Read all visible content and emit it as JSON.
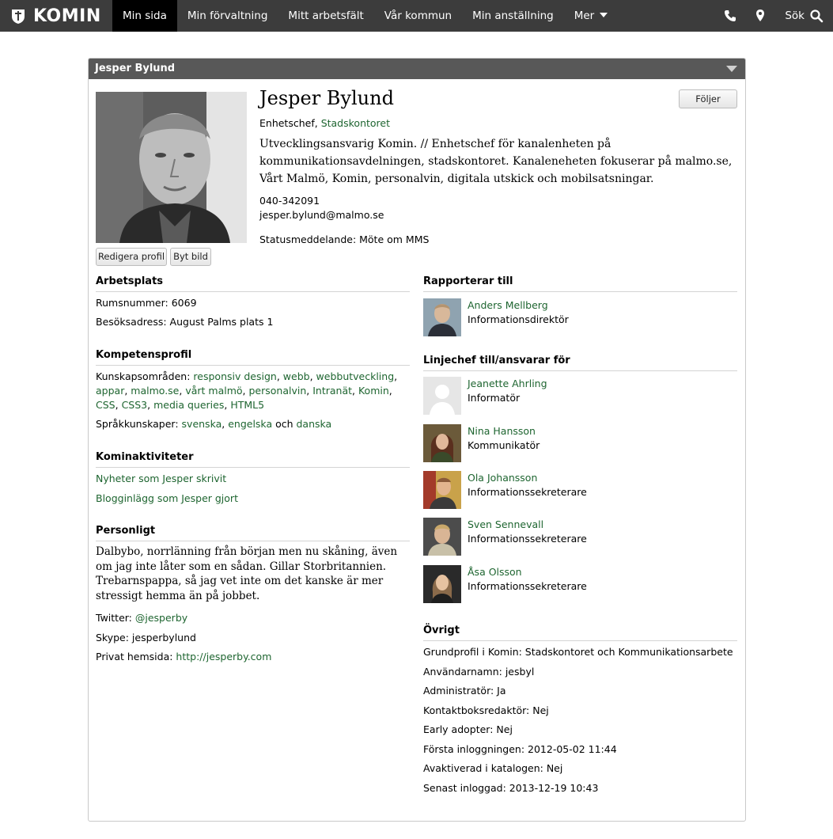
{
  "brand": "KOMIN",
  "nav": [
    {
      "label": "Min sida",
      "active": true
    },
    {
      "label": "Min förvaltning"
    },
    {
      "label": "Mitt arbetsfält"
    },
    {
      "label": "Vår kommun"
    },
    {
      "label": "Min anställning"
    },
    {
      "label": "Mer"
    }
  ],
  "topright": {
    "search_label": "Sök",
    "icons": [
      "phone-icon",
      "location-pin-icon",
      "search-icon"
    ]
  },
  "panel": {
    "title": "Jesper Bylund"
  },
  "profile": {
    "name": "Jesper Bylund",
    "role": "Enhetschef, ",
    "department": "Stadskontoret",
    "bio": "Utvecklingsansvarig Komin. // Enhetschef för kanalenheten på kommunikationsavdelningen, stadskontoret. Kanaleneheten fokuserar på malmo.se, Vårt Malmö, Komin, personalvin, digitala utskick och mobilsatsningar.",
    "phone": "040-342091",
    "email": "jesper.bylund@malmo.se",
    "status": "Statusmeddelande: Möte om MMS",
    "follow_label": "Följer",
    "edit_label": "Redigera profil",
    "change_image_label": "Byt bild"
  },
  "workplace": {
    "heading": "Arbetsplats",
    "room": "Rumsnummer: 6069",
    "address": "Besöksadress: August Palms plats 1"
  },
  "competence": {
    "heading": "Kompetensprofil",
    "areas_label": "Kunskapsområden: ",
    "areas": [
      "responsiv design",
      "webb",
      "webbutveckling",
      "appar",
      "malmo.se",
      "vårt malmö",
      "personalvin",
      "Intranät",
      "Komin",
      "CSS",
      "CSS3",
      "media queries",
      "HTML5"
    ],
    "languages_label": "Språkkunskaper: ",
    "languages": [
      "svenska",
      "engelska",
      "danska"
    ],
    "languages_and": " och "
  },
  "activities": {
    "heading": "Kominaktiviteter",
    "news": "Nyheter som Jesper skrivit",
    "blog": "Blogginlägg som Jesper gjort"
  },
  "personal": {
    "heading": "Personligt",
    "text": "Dalbybo, norrlänning från början men nu skåning, även om jag inte låter som en sådan. Gillar Storbritannien. Trebarnspappa, så jag vet inte om det kanske är mer stressigt hemma än på jobbet.",
    "twitter_label": "Twitter: ",
    "twitter": "@jesperby",
    "skype": "Skype: jesperbylund",
    "homepage_label": "Privat hemsida: ",
    "homepage": "http://jesperby.com"
  },
  "reports_to": {
    "heading": "Rapporterar till",
    "person": {
      "name": "Anders Mellberg",
      "title": "Informationsdirektör"
    }
  },
  "manages": {
    "heading": "Linjechef till/ansvarar för",
    "people": [
      {
        "name": "Jeanette Ahrling",
        "title": "Informatör"
      },
      {
        "name": "Nina Hansson",
        "title": "Kommunikatör"
      },
      {
        "name": "Ola Johansson",
        "title": "Informationssekreterare"
      },
      {
        "name": "Sven Sennevall",
        "title": "Informationssekreterare"
      },
      {
        "name": "Åsa Olsson",
        "title": "Informationssekreterare"
      }
    ]
  },
  "other": {
    "heading": "Övrigt",
    "lines": [
      "Grundprofil i Komin: Stadskontoret och Kommunikationsarbete",
      "Användarnamn: jesbyl",
      "Administratör: Ja",
      "Kontaktboksredaktör: Nej",
      "Early adopter: Nej",
      "Första inloggningen: 2012-05-02 11:44",
      "Avaktiverad i katalogen: Nej",
      "Senast inloggad: 2013-12-19 10:43"
    ]
  },
  "colors": {
    "link": "#1e6530",
    "topbar": "#3c3c3c",
    "panel_head": "#585858"
  }
}
